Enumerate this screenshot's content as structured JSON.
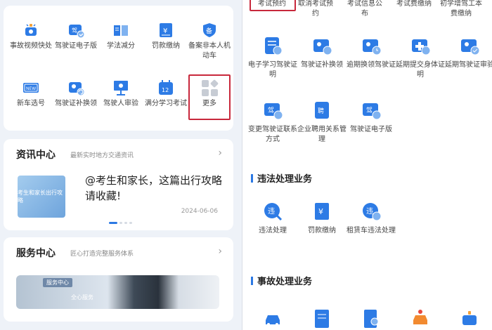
{
  "left": {
    "grid": [
      {
        "icon": "video-icon",
        "label": "事故视频快处",
        "color": "#2d7be5"
      },
      {
        "icon": "license-icon",
        "label": "驾驶证电子版",
        "color": "#2d7be5"
      },
      {
        "icon": "book-icon",
        "label": "学法减分",
        "color": "#2d7be5"
      },
      {
        "icon": "fine-icon",
        "label": "罚款缴纳",
        "color": "#2d7be5"
      },
      {
        "icon": "shield-icon",
        "label": "备案非本人机动车",
        "color": "#2d7be5"
      },
      {
        "icon": "plate-icon",
        "label": "新车选号",
        "color": "#2d7be5"
      },
      {
        "icon": "license-reissue-icon",
        "label": "驾驶证补换领",
        "color": "#2d7be5"
      },
      {
        "icon": "driver-review-icon",
        "label": "驾驶人审验",
        "color": "#2d7be5"
      },
      {
        "icon": "calendar-icon",
        "label": "满分学习考试",
        "color": "#2d7be5"
      },
      {
        "icon": "more-icon",
        "label": "更多",
        "color": "#c7ccd4"
      }
    ],
    "news": {
      "title": "资讯中心",
      "subtitle": "最新实时地方交通资讯",
      "headline": "@考生和家长，这篇出行攻略请收藏!",
      "date": "2024-06-06",
      "thumb_text": "考生和家长出行攻略"
    },
    "service": {
      "title": "服务中心",
      "subtitle": "匠心打造完整服务体系",
      "banner_tag": "服务中心",
      "banner_sub": "全心服务"
    }
  },
  "right": {
    "top_labels": [
      "考试预约",
      "取消考试预约",
      "考试信息公布",
      "考试费缴纳",
      "初学增驾工本费缴纳"
    ],
    "row1": [
      {
        "icon": "e-study-icon",
        "label": "电子学习驾驶证明"
      },
      {
        "icon": "license-reissue-icon",
        "label": "驾驶证补换领"
      },
      {
        "icon": "overdue-renew-icon",
        "label": "逾期换领驾驶证"
      },
      {
        "icon": "health-proof-icon",
        "label": "延期提交身体证明"
      },
      {
        "icon": "delay-review-icon",
        "label": "延期驾驶证审验"
      }
    ],
    "row2": [
      {
        "icon": "contact-change-icon",
        "label": "变更驾驶证联系方式"
      },
      {
        "icon": "employ-icon",
        "label": "企业聘用关系管理"
      },
      {
        "icon": "license-icon",
        "label": "驾驶证电子版"
      }
    ],
    "violation_title": "违法处理业务",
    "violation": [
      {
        "icon": "violation-icon",
        "label": "违法处理"
      },
      {
        "icon": "fine-icon",
        "label": "罚款缴纳"
      },
      {
        "icon": "rental-violation-icon",
        "label": "租赁车违法处理"
      }
    ],
    "accident_title": "事故处理业务"
  }
}
